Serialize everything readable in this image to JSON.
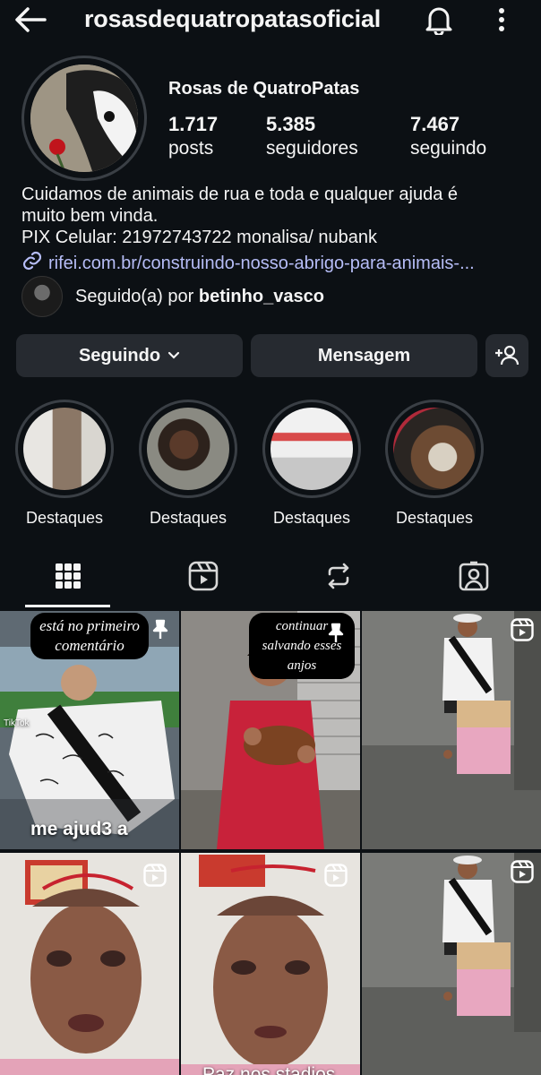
{
  "header": {
    "username": "rosasdequatropatasoficial"
  },
  "profile": {
    "display_name": "Rosas de QuatroPatas",
    "stats": [
      {
        "value": "1.717",
        "label": "posts"
      },
      {
        "value": "5.385",
        "label": "seguidores"
      },
      {
        "value": "7.467",
        "label": "seguindo"
      }
    ],
    "bio": [
      "Cuidamos de animais de rua e toda e qualquer ajuda é",
      "muito bem vinda.",
      "PIX Celular: 21972743722  monalisa/ nubank"
    ],
    "link": "rifei.com.br/construindo-nosso-abrigo-para-animais-...",
    "followed_by_prefix": "Seguido(a) por",
    "followed_by_user": "betinho_vasco"
  },
  "actions": {
    "following_label": "Seguindo",
    "message_label": "Mensagem"
  },
  "highlights": [
    {
      "label": "Destaques"
    },
    {
      "label": "Destaques"
    },
    {
      "label": "Destaques"
    },
    {
      "label": "Destaques"
    }
  ],
  "tabs": [
    "grid-icon",
    "reels-icon",
    "reposts-icon",
    "tagged-icon"
  ],
  "posts": [
    {
      "caption_top": "está no primeiro comentário",
      "bottom_text": "me ajud3 a",
      "badge": "pin-icon",
      "watermark": "TikTok"
    },
    {
      "caption_top": "continuar salvando esses anjos",
      "badge": "pin-icon"
    },
    {
      "badge": "reel-icon"
    },
    {
      "badge": "reel-icon"
    },
    {
      "badge": "reel-icon"
    },
    {
      "badge": "reel-icon",
      "bottom_text": "Paz nos stadios"
    }
  ],
  "colors": {
    "background": "#0c1014",
    "button": "#262a30",
    "link": "#b6bdf7"
  }
}
